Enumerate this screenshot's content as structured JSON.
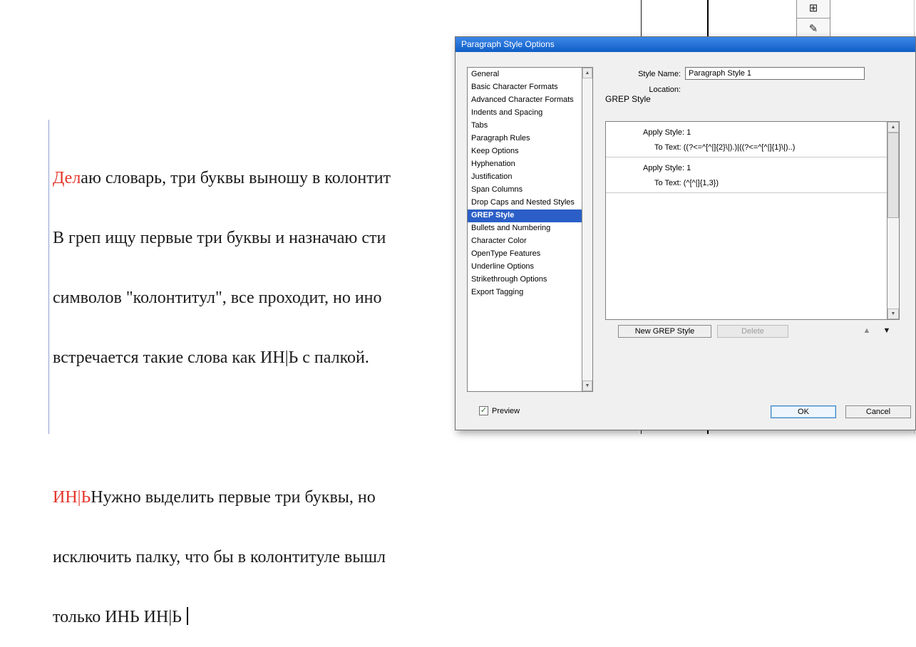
{
  "window": {
    "title": "Paragraph Style Options"
  },
  "icons": {
    "arrow_up": "▲",
    "arrow_down": "▼",
    "check": "✓",
    "tool_top": "⊞",
    "tool_bottom": "✎"
  },
  "colors": {
    "accent_red": "#e5352b",
    "selection_blue": "#2b5fc7",
    "titlebar_blue": "#0f5ec6"
  },
  "dialog": {
    "style_name_label": "Style Name:",
    "style_name_value": "Paragraph Style 1",
    "location_label": "Location:",
    "section_title": "GREP Style",
    "sidebar_items": [
      "General",
      "Basic Character Formats",
      "Advanced Character Formats",
      "Indents and Spacing",
      "Tabs",
      "Paragraph Rules",
      "Keep Options",
      "Hyphenation",
      "Justification",
      "Span Columns",
      "Drop Caps and Nested Styles",
      "GREP Style",
      "Bullets and Numbering",
      "Character Color",
      "OpenType Features",
      "Underline Options",
      "Strikethrough Options",
      "Export Tagging"
    ],
    "grep_rules": [
      {
        "apply": "Apply Style: 1",
        "to_text": "To Text: ((?<=^[^|]{2}\\|).)|((?<=^[^|]{1}\\|)..)"
      },
      {
        "apply": "Apply Style: 1",
        "to_text": "To Text: (^[^|]{1,3})"
      }
    ],
    "buttons": {
      "new_grep": "New GREP Style",
      "delete": "Delete",
      "ok": "OK",
      "cancel": "Cancel"
    },
    "preview_label": "Preview"
  },
  "doc": {
    "l1_red": "Дел",
    "l1": "аю словарь, три буквы выношу в колонтит",
    "l2": "В греп ищу первые три буквы и назначаю сти",
    "l3": "символов \"колонтитул\", все проходит, но ино",
    "l4": "встречается такие слова как ИН|Ь с палкой.",
    "l6_red": "ИН|Ь",
    "l6": "Нужно выделить первые три буквы, но",
    "l7": "исключить палку, что бы в колонтитуле вышл",
    "l8": "только ИНЬ ИН|Ь"
  }
}
